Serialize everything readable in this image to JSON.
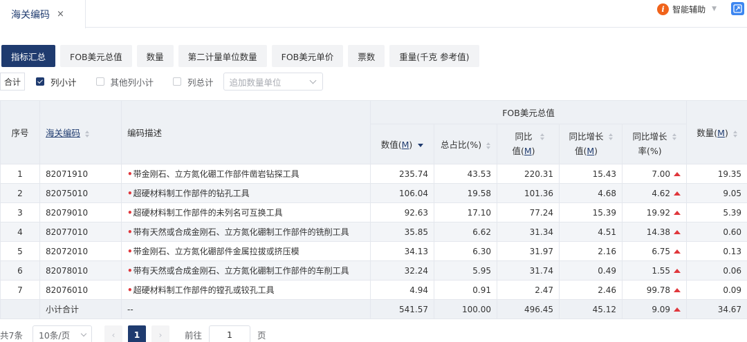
{
  "tab": {
    "label": "海关编码",
    "close": "×"
  },
  "assistant": {
    "label": "智能辅助"
  },
  "metrics": [
    "指标汇总",
    "FOB美元总值",
    "数量",
    "第二计量单位数量",
    "FOB美元单价",
    "票数",
    "重量(千克 参考值)"
  ],
  "options": {
    "total_label": "合计",
    "subtotal_label": "列小计",
    "other_subtotal_label": "其他列小计",
    "grand_total_label": "列总计",
    "unit_placeholder": "追加数量单位"
  },
  "table": {
    "headers": {
      "seq": "序号",
      "code": "海关编码",
      "desc": "编码描述",
      "fob_group": "FOB美元总值",
      "value_pre": "数值(",
      "unit_m": "M",
      "value_post": ")",
      "ratio": "总占比(%)",
      "yoy_line1": "同比",
      "yoy_pre": "值(",
      "yoy_post": ")",
      "yoy_inc_line1": "同比增长",
      "yoy_inc_pre": "值(",
      "yoy_inc_post": ")",
      "yoy_rate_line1": "同比增长",
      "yoy_rate_line2": "率(%)",
      "qty_pre": "数量(",
      "qty_post": ")"
    },
    "rows": [
      {
        "seq": "1",
        "code": "82071910",
        "desc": "带金刚石、立方氮化硼工作部件凿岩钻探工具",
        "value": "235.74",
        "ratio": "43.53",
        "yoy": "220.31",
        "yoy_inc": "15.43",
        "yoy_rate": "7.00",
        "qty": "19.35"
      },
      {
        "seq": "2",
        "code": "82075010",
        "desc": "超硬材料制工作部件的钻孔工具",
        "value": "106.04",
        "ratio": "19.58",
        "yoy": "101.36",
        "yoy_inc": "4.68",
        "yoy_rate": "4.62",
        "qty": "9.05"
      },
      {
        "seq": "3",
        "code": "82079010",
        "desc": "超硬材料制工作部件的未列名可互换工具",
        "value": "92.63",
        "ratio": "17.10",
        "yoy": "77.24",
        "yoy_inc": "15.39",
        "yoy_rate": "19.92",
        "qty": "5.39"
      },
      {
        "seq": "4",
        "code": "82077010",
        "desc": "带有天然或合成金刚石、立方氮化硼制工作部件的铣削工具",
        "value": "35.85",
        "ratio": "6.62",
        "yoy": "31.34",
        "yoy_inc": "4.51",
        "yoy_rate": "14.38",
        "qty": "0.60"
      },
      {
        "seq": "5",
        "code": "82072010",
        "desc": "带金刚石、立方氮化硼部件金属拉拔或挤压模",
        "value": "34.13",
        "ratio": "6.30",
        "yoy": "31.97",
        "yoy_inc": "2.16",
        "yoy_rate": "6.75",
        "qty": "0.13"
      },
      {
        "seq": "6",
        "code": "82078010",
        "desc": "带有天然或合成金刚石、立方氮化硼制工作部件的车削工具",
        "value": "32.24",
        "ratio": "5.95",
        "yoy": "31.74",
        "yoy_inc": "0.49",
        "yoy_rate": "1.55",
        "qty": "0.06"
      },
      {
        "seq": "7",
        "code": "82076010",
        "desc": "超硬材料制工作部件的镗孔或铰孔工具",
        "value": "4.94",
        "ratio": "0.91",
        "yoy": "2.47",
        "yoy_inc": "2.46",
        "yoy_rate": "99.78",
        "qty": "0.09"
      }
    ],
    "subtotal": {
      "label": "小计合计",
      "desc": "--",
      "value": "541.57",
      "ratio": "100.00",
      "yoy": "496.45",
      "yoy_inc": "45.12",
      "yoy_rate": "9.09",
      "qty": "34.67"
    }
  },
  "pagination": {
    "total_text": "共7条",
    "page_size": "10条/页",
    "prev": "‹",
    "current_page": "1",
    "next": "›",
    "goto_label": "前往",
    "goto_value": "1",
    "goto_unit": "页"
  }
}
